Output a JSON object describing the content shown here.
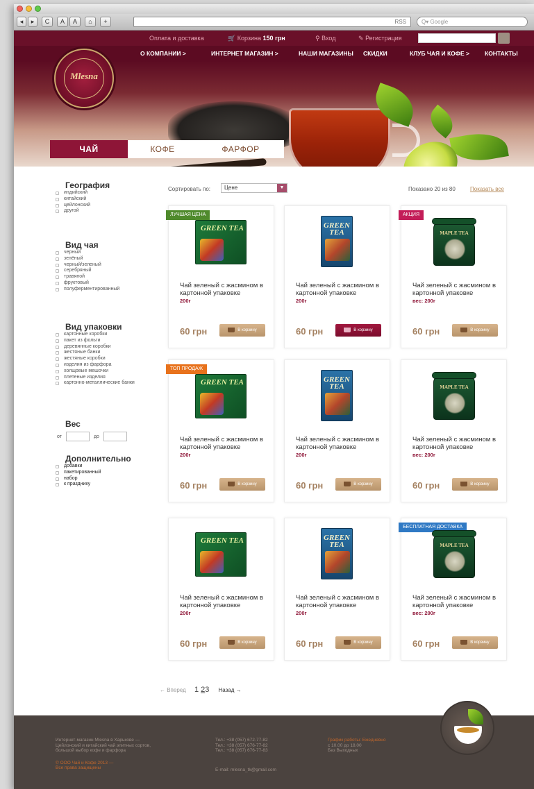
{
  "browser": {
    "buttons": [
      "◂",
      "▸",
      "C",
      "A",
      "A",
      "⌂",
      "+"
    ],
    "rss": "RSS",
    "search_placeholder": "Q▾ Google"
  },
  "header": {
    "top_links": {
      "delivery": "Оплата и доставка",
      "cart_label": "Корзина",
      "cart_price": "150 грн",
      "login": "Вход",
      "register": "Регистрация"
    },
    "logo_text": "Mlesna",
    "nav": [
      "О КОМПАНИИ >",
      "ИНТЕРНЕТ МАГАЗИН >",
      "НАШИ МАГАЗИНЫ",
      "СКИДКИ",
      "КЛУБ ЧАЯ И КОФЕ >",
      "КОНТАКТЫ"
    ],
    "category_tabs": [
      "ЧАЙ",
      "КОФЕ",
      "ФАРФОР"
    ]
  },
  "filters": {
    "geography": {
      "title": "География",
      "options": [
        "индийский",
        "китайский",
        "цейлонский",
        "другой"
      ]
    },
    "tea_type": {
      "title": "Вид чая",
      "options": [
        "черный",
        "зелёный",
        "черный/зеленый",
        "серебряный",
        "травяной",
        "фруктовый",
        "полуферментированный"
      ]
    },
    "packaging": {
      "title": "Вид упаковки",
      "options": [
        "картонные коробки",
        "пакет из фольги",
        "деревянные коробки",
        "жестяные банки",
        "жестяные коробки",
        "изделия из фарфора",
        "холщовые мешочки",
        "плетеные изделия",
        "картонно-металлические банки"
      ]
    },
    "weight": {
      "title": "Вес",
      "from_label": "от",
      "to_label": "до"
    },
    "extra": {
      "title": "Дополнительно",
      "options": [
        "добавки",
        "пакетированный",
        "набор",
        "к празднику"
      ]
    }
  },
  "sort": {
    "label": "Сортировать по:",
    "value": "Цене",
    "shown": "Показано 20 из 80",
    "show_all": "Показать все"
  },
  "products": [
    {
      "badge": "ЛУЧШАЯ ЦЕНА",
      "badge_color": "green",
      "pack": "box-green",
      "name": "Чай зеленый с жасмином в картонной упаковке",
      "weight": "200г",
      "price": "60 грн",
      "buy": "В корзину",
      "buy_active": false
    },
    {
      "badge": "",
      "badge_color": "",
      "pack": "box-blue",
      "name": "Чай зеленый с жасмином в картонной упаковке",
      "weight": "200г",
      "price": "60 грн",
      "buy": "В корзину",
      "buy_active": true
    },
    {
      "badge": "АКЦИЯ",
      "badge_color": "pink",
      "pack": "tin",
      "name": "Чай зеленый с жасмином в картонной упаковке",
      "weight": "вес: 200г",
      "price": "60 грн",
      "buy": "В корзину",
      "buy_active": false
    },
    {
      "badge": "ТОП ПРОДАЖ",
      "badge_color": "orange",
      "pack": "box-green",
      "name": "Чай зеленый с жасмином в картонной упаковке",
      "weight": "200г",
      "price": "60 грн",
      "buy": "В корзину",
      "buy_active": false
    },
    {
      "badge": "",
      "badge_color": "",
      "pack": "box-blue",
      "name": "Чай зеленый с жасмином в картонной упаковке",
      "weight": "200г",
      "price": "60 грн",
      "buy": "В корзину",
      "buy_active": false
    },
    {
      "badge": "",
      "badge_color": "",
      "pack": "tin",
      "name": "Чай зеленый с жасмином в картонной упаковке",
      "weight": "вес: 200г",
      "price": "60 грн",
      "buy": "В корзину",
      "buy_active": false
    },
    {
      "badge": "",
      "badge_color": "",
      "pack": "box-green",
      "name": "Чай зеленый с жасмином в картонной упаковке",
      "weight": "200г",
      "price": "60 грн",
      "buy": "В корзину",
      "buy_active": false
    },
    {
      "badge": "",
      "badge_color": "",
      "pack": "box-blue",
      "name": "Чай зеленый с жасмином в картонной упаковке",
      "weight": "200г",
      "price": "60 грн",
      "buy": "В корзину",
      "buy_active": false
    },
    {
      "badge": "БЕСПЛАТНАЯ ДОСТАВКА",
      "badge_color": "blue",
      "pack": "tin",
      "name": "Чай зеленый с жасмином в картонной упаковке",
      "weight": "вес: 200г",
      "price": "60 грн",
      "buy": "В корзину",
      "buy_active": false
    }
  ],
  "pack_labels": {
    "box-green": "GREEN TEA",
    "box-blue": "GREEN TEA",
    "tin": "MAPLE TEA"
  },
  "pager": {
    "prev": "← Вперед",
    "pages": [
      "1",
      "2",
      "3"
    ],
    "current": "2",
    "next": "Назад →"
  },
  "footer": {
    "about": [
      "Интернет-магазин Mlesna в Харькове —",
      "Цейлонский и китайский чай элитных сортов,",
      "большой выбор кофе и фарфора"
    ],
    "copyright": [
      "© ООО Чай и Кофе 2013 —",
      "Все права защищены"
    ],
    "phones": [
      "Тел.: +38 (057) 672-77-82",
      "Тел.: +38 (057) 676-77-82",
      "Тел.: +38 (057) 676-77-83"
    ],
    "email": "E-mail: mlesna_tk@gmail.com",
    "hours_title": "График работы: Ежедневно",
    "hours": [
      "с 10.00 до 18.00",
      "Без Выходных"
    ]
  },
  "colors": {
    "brand": "#8e1537",
    "accent": "#b58a5a",
    "footer_bg": "#4b433f"
  }
}
